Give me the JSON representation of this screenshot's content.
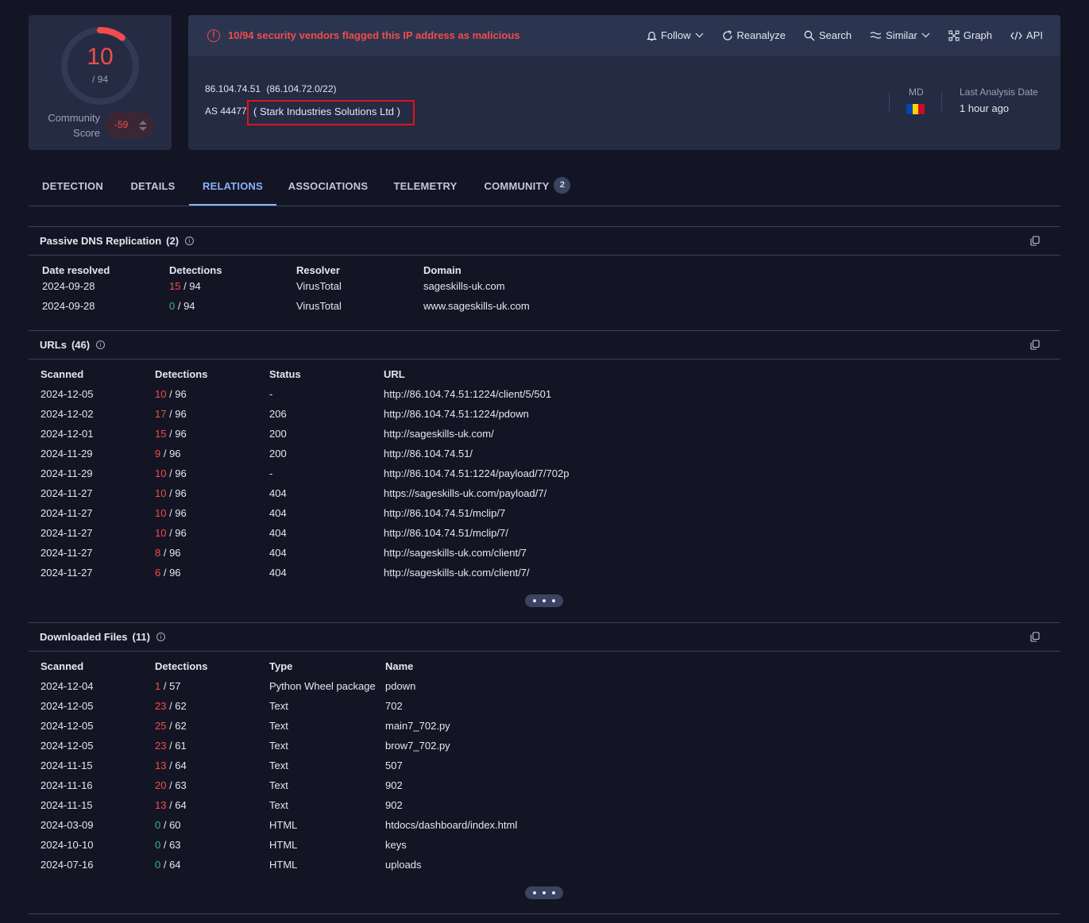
{
  "score": {
    "value": "10",
    "total": "/ 94",
    "community_label_1": "Community",
    "community_label_2": "Score",
    "community_value": "-59"
  },
  "alert": {
    "text": "10/94 security vendors flagged this IP address as malicious"
  },
  "actions": [
    {
      "label": "Follow",
      "icon": "bell-icon"
    },
    {
      "label": "Reanalyze",
      "icon": "refresh-icon"
    },
    {
      "label": "Search",
      "icon": "search-icon"
    },
    {
      "label": "Similar",
      "icon": "similar-icon"
    },
    {
      "label": "Graph",
      "icon": "graph-icon"
    },
    {
      "label": "API",
      "icon": "api-icon"
    }
  ],
  "ip": {
    "address": "86.104.74.51",
    "range": "(86.104.72.0/22)",
    "as": "AS 44477",
    "org": "( Stark Industries Solutions Ltd )"
  },
  "country": {
    "code": "MD",
    "flag_colors": [
      "#0046ae",
      "#ffd200",
      "#cc092f"
    ]
  },
  "last_analysis": {
    "label": "Last Analysis Date",
    "value": "1 hour ago"
  },
  "tabs": [
    {
      "label": "DETECTION"
    },
    {
      "label": "DETAILS"
    },
    {
      "label": "RELATIONS",
      "active": true
    },
    {
      "label": "ASSOCIATIONS"
    },
    {
      "label": "TELEMETRY"
    },
    {
      "label": "COMMUNITY",
      "badge": "2"
    }
  ],
  "passive_dns": {
    "title": "Passive DNS Replication",
    "count": "(2)",
    "headers": [
      "Date resolved",
      "Detections",
      "Resolver",
      "Domain"
    ],
    "rows": [
      {
        "date": "2024-09-28",
        "det": "15",
        "det_total": "/ 94",
        "resolver": "VirusTotal",
        "domain": "sageskills-uk.com"
      },
      {
        "date": "2024-09-28",
        "det": "0",
        "det_total": "/ 94",
        "resolver": "VirusTotal",
        "domain": "www.sageskills-uk.com"
      }
    ]
  },
  "urls": {
    "title": "URLs",
    "count": "(46)",
    "headers": [
      "Scanned",
      "Detections",
      "Status",
      "URL"
    ],
    "rows": [
      {
        "scanned": "2024-12-05",
        "det": "10",
        "det_total": "/ 96",
        "status": "-",
        "url": "http://86.104.74.51:1224/client/5/501"
      },
      {
        "scanned": "2024-12-02",
        "det": "17",
        "det_total": "/ 96",
        "status": "206",
        "url": "http://86.104.74.51:1224/pdown"
      },
      {
        "scanned": "2024-12-01",
        "det": "15",
        "det_total": "/ 96",
        "status": "200",
        "url": "http://sageskills-uk.com/"
      },
      {
        "scanned": "2024-11-29",
        "det": "9",
        "det_total": "/ 96",
        "status": "200",
        "url": "http://86.104.74.51/"
      },
      {
        "scanned": "2024-11-29",
        "det": "10",
        "det_total": "/ 96",
        "status": "-",
        "url": "http://86.104.74.51:1224/payload/7/702p"
      },
      {
        "scanned": "2024-11-27",
        "det": "10",
        "det_total": "/ 96",
        "status": "404",
        "url": "https://sageskills-uk.com/payload/7/"
      },
      {
        "scanned": "2024-11-27",
        "det": "10",
        "det_total": "/ 96",
        "status": "404",
        "url": "http://86.104.74.51/mclip/7"
      },
      {
        "scanned": "2024-11-27",
        "det": "10",
        "det_total": "/ 96",
        "status": "404",
        "url": "http://86.104.74.51/mclip/7/"
      },
      {
        "scanned": "2024-11-27",
        "det": "8",
        "det_total": "/ 96",
        "status": "404",
        "url": "http://sageskills-uk.com/client/7"
      },
      {
        "scanned": "2024-11-27",
        "det": "6",
        "det_total": "/ 96",
        "status": "404",
        "url": "http://sageskills-uk.com/client/7/"
      }
    ]
  },
  "files": {
    "title": "Downloaded Files",
    "count": "(11)",
    "headers": [
      "Scanned",
      "Detections",
      "Type",
      "Name"
    ],
    "rows": [
      {
        "scanned": "2024-12-04",
        "det": "1",
        "det_total": "/ 57",
        "type": "Python Wheel package",
        "name": "pdown"
      },
      {
        "scanned": "2024-12-05",
        "det": "23",
        "det_total": "/ 62",
        "type": "Text",
        "name": "702"
      },
      {
        "scanned": "2024-12-05",
        "det": "25",
        "det_total": "/ 62",
        "type": "Text",
        "name": "main7_702.py"
      },
      {
        "scanned": "2024-12-05",
        "det": "23",
        "det_total": "/ 61",
        "type": "Text",
        "name": "brow7_702.py"
      },
      {
        "scanned": "2024-11-15",
        "det": "13",
        "det_total": "/ 64",
        "type": "Text",
        "name": "507"
      },
      {
        "scanned": "2024-11-16",
        "det": "20",
        "det_total": "/ 63",
        "type": "Text",
        "name": "902"
      },
      {
        "scanned": "2024-11-15",
        "det": "13",
        "det_total": "/ 64",
        "type": "Text",
        "name": "902"
      },
      {
        "scanned": "2024-03-09",
        "det": "0",
        "det_total": "/ 60",
        "type": "HTML",
        "name": "htdocs/dashboard/index.html"
      },
      {
        "scanned": "2024-10-10",
        "det": "0",
        "det_total": "/ 63",
        "type": "HTML",
        "name": "keys"
      },
      {
        "scanned": "2024-07-16",
        "det": "0",
        "det_total": "/ 64",
        "type": "HTML",
        "name": "uploads"
      }
    ]
  },
  "colors": {
    "malicious": "#f14c4c",
    "clean": "#38b38a",
    "accent": "#88b4ff",
    "background": "#141524",
    "card": "#242b42"
  }
}
